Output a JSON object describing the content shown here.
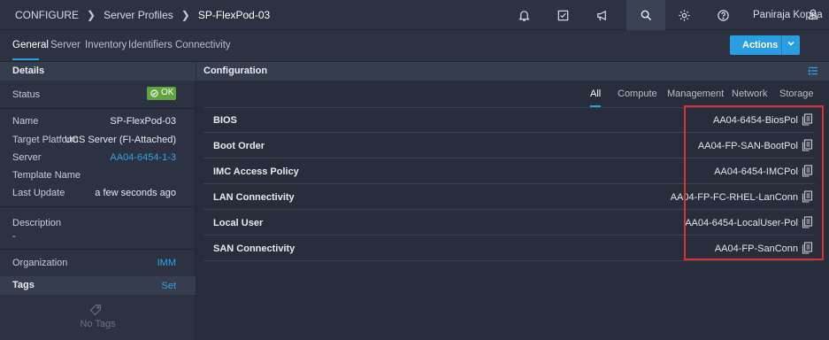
{
  "breadcrumbs": [
    "CONFIGURE",
    "Server Profiles",
    "SP-FlexPod-03"
  ],
  "user": {
    "name": "Paniraja Koppa"
  },
  "top_icons": [
    "bell-icon",
    "checklist-icon",
    "megaphone-icon",
    "search-icon",
    "gear-icon",
    "help-icon"
  ],
  "tabs": [
    {
      "label": "General",
      "active": true
    },
    {
      "label": "Server"
    },
    {
      "label": "Inventory"
    },
    {
      "label": "Identifiers"
    },
    {
      "label": "Connectivity"
    }
  ],
  "actions_label": "Actions",
  "details": {
    "title": "Details",
    "status_label": "Status",
    "status_value": "OK",
    "fields": [
      {
        "label": "Name",
        "value": "SP-FlexPod-03"
      },
      {
        "label": "Target Platform",
        "value": "UCS Server (FI-Attached)"
      },
      {
        "label": "Server",
        "value": "AA04-6454-1-3"
      },
      {
        "label": "Template Name",
        "value": ""
      },
      {
        "label": "Last Update",
        "value": "a few seconds ago"
      }
    ],
    "description_label": "Description",
    "description_value": "-",
    "organization_label": "Organization",
    "organization_value": "IMM"
  },
  "tags": {
    "title": "Tags",
    "set_label": "Set",
    "empty_label": "No Tags"
  },
  "configuration": {
    "title": "Configuration",
    "filters": [
      {
        "label": "All",
        "active": true
      },
      {
        "label": "Compute"
      },
      {
        "label": "Management"
      },
      {
        "label": "Network"
      },
      {
        "label": "Storage"
      }
    ],
    "policies": [
      {
        "name": "BIOS",
        "value": "AA04-6454-BiosPol"
      },
      {
        "name": "Boot Order",
        "value": "AA04-FP-SAN-BootPol"
      },
      {
        "name": "IMC Access Policy",
        "value": "AA04-6454-IMCPol"
      },
      {
        "name": "LAN Connectivity",
        "value": "AA04-FP-FC-RHEL-LanConn"
      },
      {
        "name": "Local User",
        "value": "AA04-6454-LocalUser-Pol"
      },
      {
        "name": "SAN Connectivity",
        "value": "AA04-FP-SanConn"
      }
    ]
  },
  "colors": {
    "accent": "#2a9ee0",
    "ok": "#5fa53e",
    "highlight": "#d9332d"
  }
}
